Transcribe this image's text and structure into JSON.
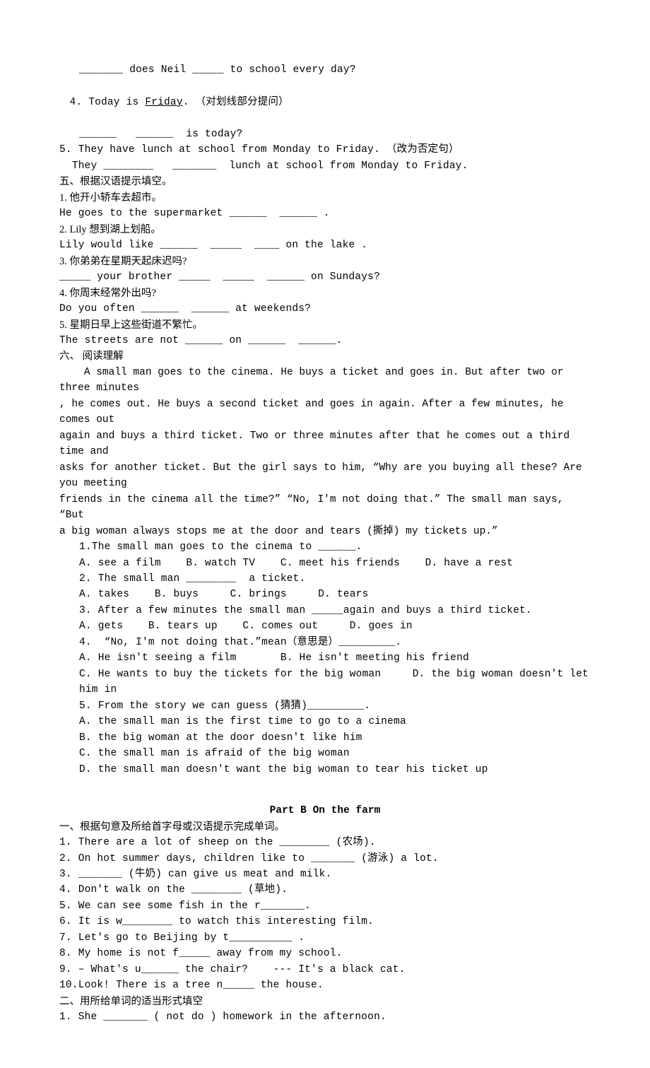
{
  "top": {
    "l1": "_______ does Neil _____ to school every day?",
    "l2_a": "4. Today is ",
    "l2_u": "Friday",
    "l2_b": ". （对划线部分提问）",
    "l3": "______   ______  is today?",
    "l4": "5. They have lunch at school from Monday to Friday. （改为否定句）",
    "l5": "  They ________   _______  lunch at school from Monday to Friday."
  },
  "sec5": {
    "title": "五、根据汉语提示填空。",
    "q1cn": "1. 他开小轿车去超市。",
    "q1en": "He goes to the supermarket ______  ______ .",
    "q2cn": "2. Lily 想到湖上划船。",
    "q2en": "Lily would like ______  _____  ____ on the lake .",
    "q3cn": "3. 你弟弟在星期天起床迟吗?",
    "q3en": "_____ your brother _____  _____  ______ on Sundays?",
    "q4cn": "4. 你周末经常外出吗?",
    "q4en": "Do you often ______  ______ at weekends?",
    "q5cn": "5. 星期日早上这些街道不繁忙。",
    "q5en": "The streets are not ______ on ______  ______."
  },
  "sec6": {
    "title": "六、 阅读理解",
    "p1": "    A small man goes to the cinema. He buys a ticket and goes in. But after two or three minutes",
    "p2": ", he comes out. He buys a second ticket and goes in again. After a few minutes, he comes out",
    "p3": "again and buys a third ticket. Two or three minutes after that he comes out a third time and",
    "p4": "asks for another ticket. But the girl says to him, “Why are you buying all these? Are you meeting",
    "p5": "friends in the cinema all the time?” “No, I'm not doing that.” The small man says, “But",
    "p6": "a big woman always stops me at the door and tears (撕掉) my tickets up.”",
    "q1": "1.The small man goes to the cinema to ______.",
    "q1o": "A. see a film    B. watch TV    C. meet his friends    D. have a rest",
    "q2": "2. The small man ________  a ticket.",
    "q2o": "A. takes    B. buys     C. brings     D. tears",
    "q3": "3. After a few minutes the small man _____again and buys a third ticket.",
    "q3o": "A. gets    B. tears up    C. comes out     D. goes in",
    "q4": "4.  “No, I'm not doing that.”mean（意思是）_________.",
    "q4a": "A. He isn't seeing a film       B. He isn't meeting his friend",
    "q4b": "C. He wants to buy the tickets for the big woman     D. the big woman doesn't let him in",
    "q5": "5. From the story we can guess (猜猜)_________.",
    "q5a": "A. the small man is the first time to go to a cinema",
    "q5b": "B. the big woman at the door doesn't like him",
    "q5c": "C. the small man is afraid of the big woman",
    "q5d": "D. the small man doesn't want the big woman to tear his ticket up"
  },
  "partB": {
    "title": "Part B    On the farm",
    "s1title": "一、根据句意及所给首字母或汉语提示完成单词。",
    "s1": {
      "1": "1. There are a lot of sheep on the ________ (农场).",
      "2": "2. On hot summer days, children like to _______ (游泳) a lot.",
      "3": "3. _______ (牛奶) can give us meat and milk.",
      "4": "4. Don't walk on the ________ (草地).",
      "5": "5. We can see some fish in the r_______.",
      "6": "6. It is w________ to watch this interesting film.",
      "7": "7. Let's go to Beijing by t__________ .",
      "8": "8. My home is not f_____ away from my school.",
      "9": "9. – What's u______ the chair?    --- It's a black cat.",
      "10": "10.Look! There is a tree n_____ the house."
    },
    "s2title": "二、用所给单词的适当形式填空",
    "s2": {
      "1": "1. She _______ ( not do ) homework in the afternoon."
    }
  }
}
